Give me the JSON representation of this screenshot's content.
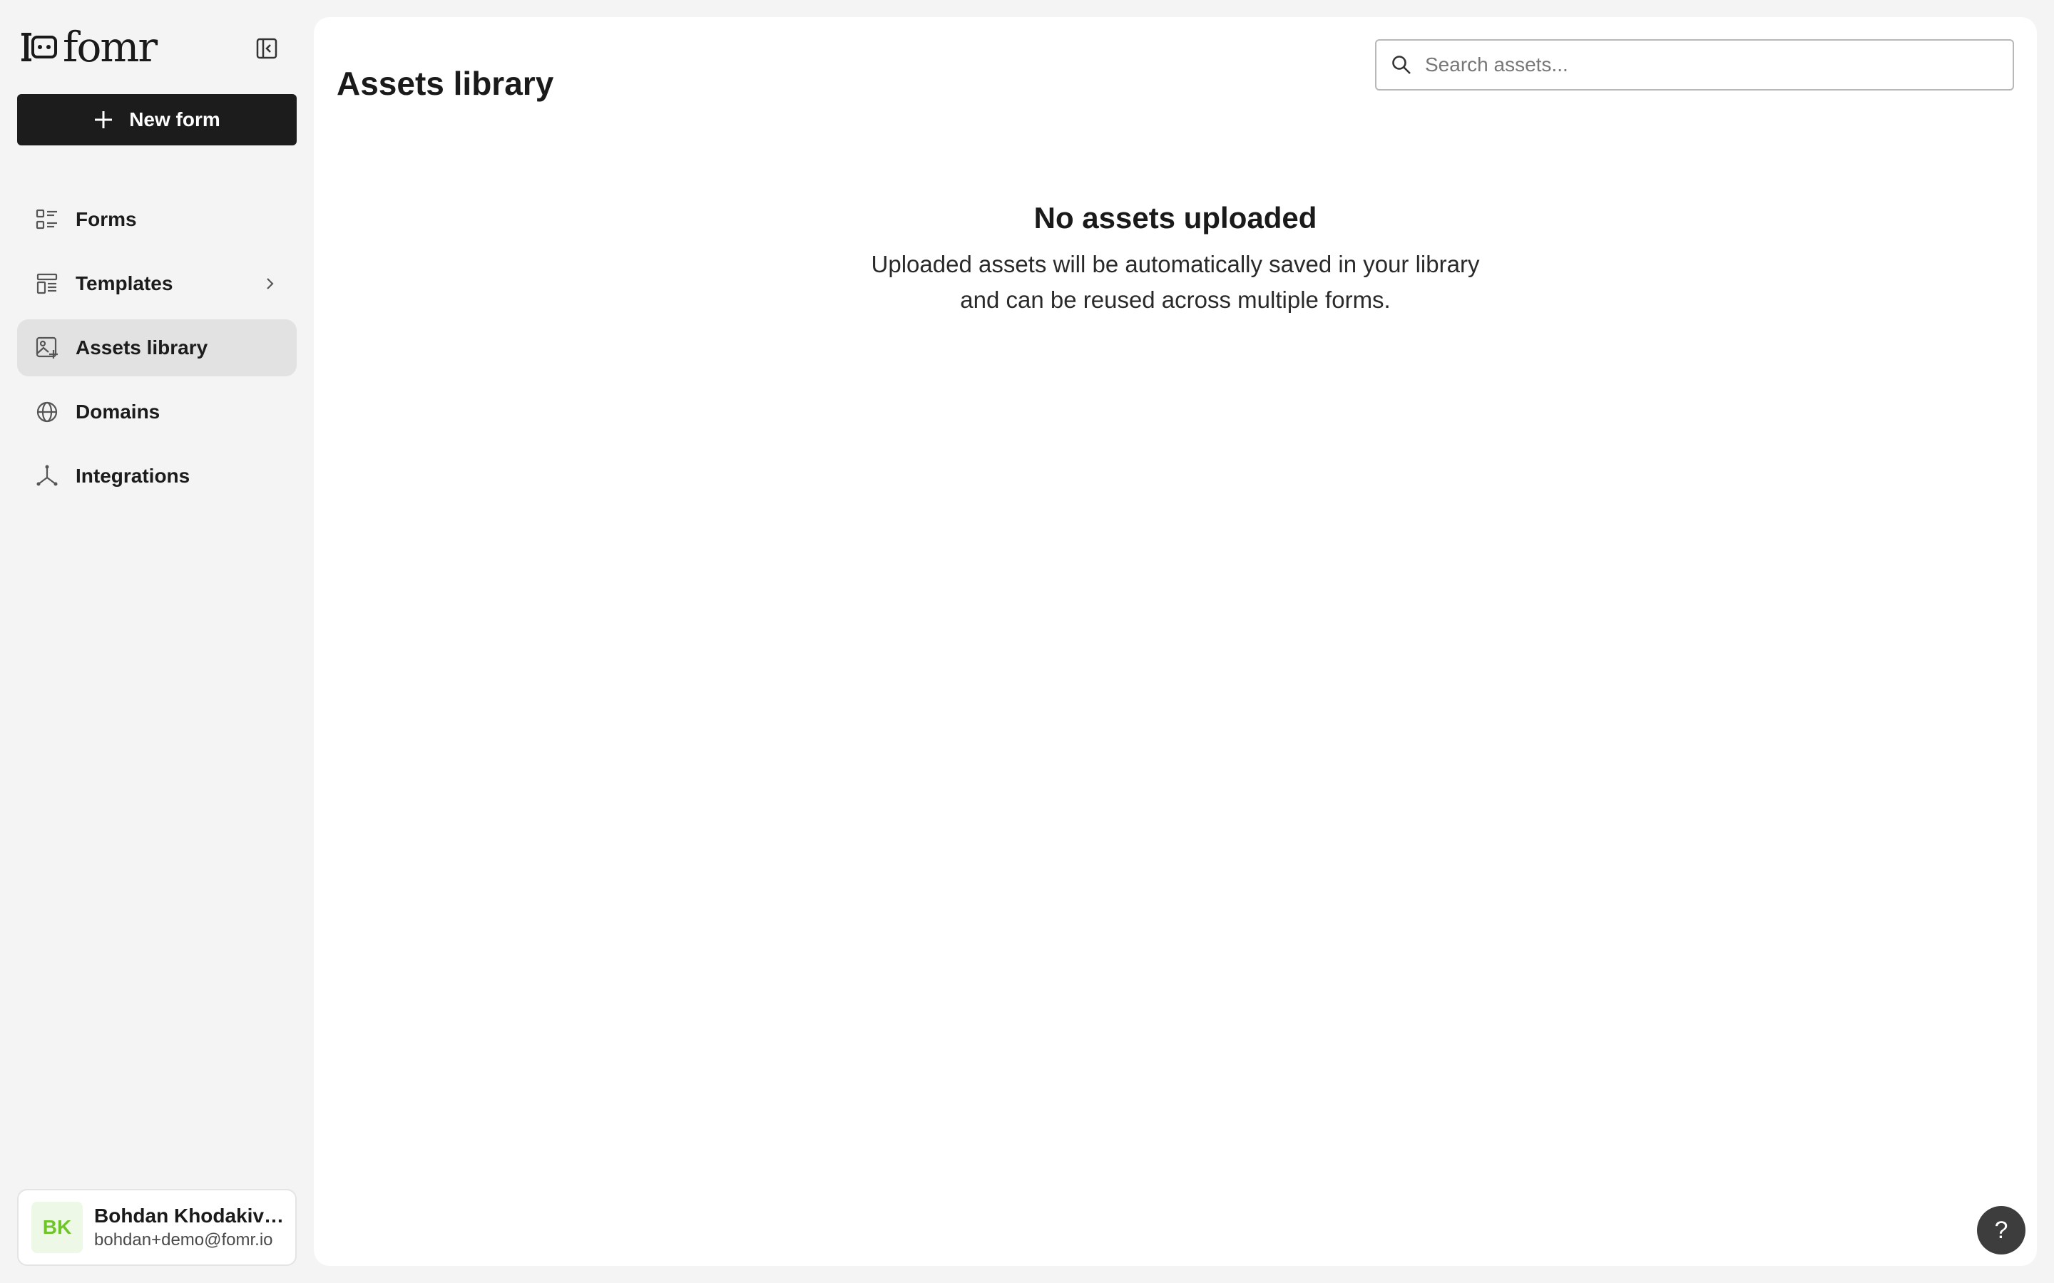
{
  "brand": {
    "name": "fomr"
  },
  "sidebar": {
    "new_form_label": "New form",
    "items": [
      {
        "label": "Forms",
        "icon": "forms-list-icon",
        "active": false
      },
      {
        "label": "Templates",
        "icon": "templates-icon",
        "active": false,
        "has_chevron": true
      },
      {
        "label": "Assets library",
        "icon": "image-assets-icon",
        "active": true
      },
      {
        "label": "Domains",
        "icon": "globe-icon",
        "active": false
      },
      {
        "label": "Integrations",
        "icon": "integrations-icon",
        "active": false
      }
    ],
    "user": {
      "initials": "BK",
      "name": "Bohdan Khodakivskyi",
      "email": "bohdan+demo@fomr.io"
    }
  },
  "main": {
    "title": "Assets library",
    "search": {
      "placeholder": "Search assets...",
      "value": ""
    },
    "empty_state": {
      "title": "No assets uploaded",
      "line1": "Uploaded assets will be automatically saved in your library",
      "line2": "and can be reused across multiple forms."
    }
  },
  "help": {
    "label": "?"
  },
  "colors": {
    "page_bg": "#f4f4f4",
    "primary_button": "#1c1c1c",
    "active_nav": "#e2e2e2",
    "avatar_bg": "#eef8e6",
    "avatar_text": "#6fc42a",
    "help_button": "#3d3d3d"
  }
}
